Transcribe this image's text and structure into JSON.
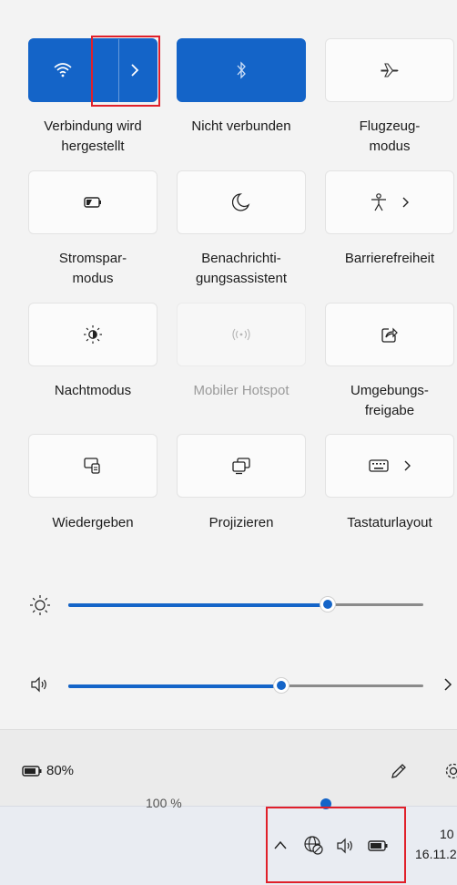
{
  "tiles": {
    "wifi_label": "Verbindung wird\nhergestellt",
    "bluetooth_label": "Nicht verbunden",
    "airplane_label": "Flugzeug-\nmodus",
    "battery_saver_label": "Stromspar-\nmodus",
    "focus_label": "Benachrichti-\ngungsassistent",
    "accessibility_label": "Barrierefreiheit",
    "night_light_label": "Nachtmodus",
    "hotspot_label": "Mobiler Hotspot",
    "nearby_share_label": "Umgebungs-\nfreigabe",
    "cast_label": "Wiedergeben",
    "project_label": "Projizieren",
    "keyboard_layout_label": "Tastaturlayout"
  },
  "sliders": {
    "brightness_level": 0.73,
    "volume_level": 0.6
  },
  "footer": {
    "battery_percent": "80%",
    "edit_icon": "pencil-icon",
    "settings_icon": "gear-icon"
  },
  "taskbar": {
    "hidden_slider_text": "100 %",
    "clock_time": "10",
    "clock_date": "16.11.2"
  },
  "colors": {
    "accent": "#1464c8",
    "highlight": "#e0202a"
  }
}
